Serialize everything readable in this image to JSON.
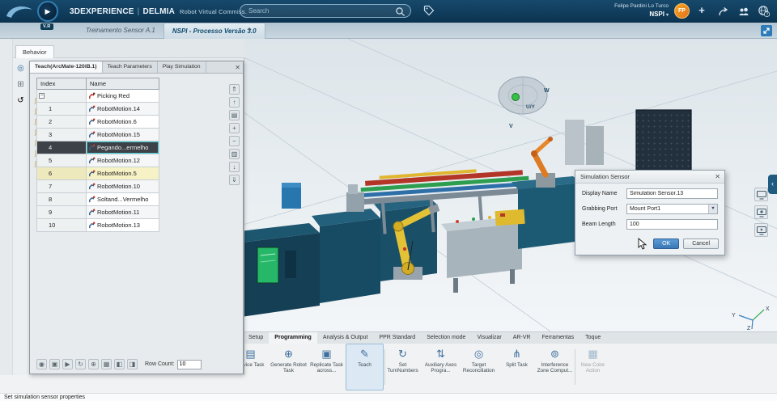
{
  "top_bar": {
    "brand": "3DEXPERIENCE",
    "divider": "|",
    "app": "DELMIA",
    "app_role": "Robot Virtual Commiss.",
    "vr_badge": "V.R",
    "search": {
      "placeholder": "Search"
    },
    "user": {
      "name": "Felipe Pardini Lo Turco",
      "workspace": "NSPI",
      "workspace_caret": "▾",
      "initials": "FP"
    }
  },
  "tab_bar": {
    "tabs": [
      {
        "label": "Treinamento Sensor A.1"
      },
      {
        "label": "NSPI - Processo Versão 3.0",
        "active": true
      }
    ],
    "new_tab": "+"
  },
  "left_panel": {
    "behavior_tab": "Behavior",
    "panel_tools": [
      "vr-compass-icon",
      "behavior-tree-icon",
      "simulation-loop-icon"
    ]
  },
  "teach_window": {
    "tabs": [
      {
        "label": "Teach(ArcMate-120iB.1)",
        "active": true
      },
      {
        "label": "Teach Parameters"
      },
      {
        "label": "Play Simulation"
      }
    ],
    "close": "✕",
    "columns": [
      "Index",
      "Name"
    ],
    "rows": [
      {
        "index": "",
        "name": "Picking Red",
        "group": true
      },
      {
        "index": "1",
        "name": "RobotMotion.14"
      },
      {
        "index": "2",
        "name": "RobotMotion.6"
      },
      {
        "index": "3",
        "name": "RobotMotion.15"
      },
      {
        "index": "4",
        "name": "Pegando...ermelho",
        "selected": true
      },
      {
        "index": "5",
        "name": "RobotMotion.12"
      },
      {
        "index": "6",
        "name": "RobotMotion.5",
        "highlighted": true
      },
      {
        "index": "7",
        "name": "RobotMotion.10"
      },
      {
        "index": "8",
        "name": "Soltand...Vermelho"
      },
      {
        "index": "9",
        "name": "RobotMotion.11"
      },
      {
        "index": "10",
        "name": "RobotMotion.13"
      }
    ],
    "row_tools": [
      "motion-type-icon",
      "motion-type-icon",
      "motion-type-icon",
      "motion-type-icon",
      "motion-type-icon",
      "motion-type-icon",
      "motion-type-icon"
    ],
    "right_tools": [
      "scroll-top-icon",
      "scroll-up-icon",
      "table-grid-icon",
      "add-row-icon",
      "remove-row-icon",
      "table-grid-alt-icon",
      "scroll-down-icon",
      "scroll-bottom-icon"
    ],
    "footer_tools": [
      "target-icon",
      "grid-select-icon",
      "play-icon",
      "refresh-icon",
      "insert-icon",
      "matrix-icon",
      "panel-left-icon",
      "panel-right-icon"
    ],
    "row_count_label": "Row Count:",
    "row_count_value": "10"
  },
  "sensor_dialog": {
    "title": "Simulation Sensor",
    "close": "✕",
    "select_caret": "▼",
    "fields": {
      "display_name_label": "Display Name",
      "display_name_value": "Simulation Sensor.13",
      "grabbing_port_label": "Grabbing Port",
      "grabbing_port_value": "Mount Port1",
      "beam_length_label": "Beam Length",
      "beam_length_value": "100"
    },
    "ok": "OK",
    "cancel": "Cancel"
  },
  "viewport": {
    "compass": {
      "w": "W",
      "uy": "U/Y",
      "v": "V"
    },
    "axes": {
      "x": "X",
      "y": "Y",
      "z": "Z"
    }
  },
  "ribbon": {
    "tabs": [
      {
        "label": "Setup"
      },
      {
        "label": "Programming",
        "active": true
      },
      {
        "label": "Analysis & Output"
      },
      {
        "label": "PPR Standard"
      },
      {
        "label": "Selection mode"
      },
      {
        "label": "Visualizar"
      },
      {
        "label": "AR-VR"
      },
      {
        "label": "Ferramentas"
      },
      {
        "label": "Toque"
      }
    ],
    "buttons": [
      {
        "label": "Device Task",
        "icon": "device-task-icon"
      },
      {
        "label": "Generate Robot Task",
        "icon": "generate-robot-task-icon"
      },
      {
        "label": "Replicate Task across...",
        "icon": "replicate-task-icon",
        "divider_after": true
      },
      {
        "label": "Teach",
        "icon": "teach-icon",
        "active": true,
        "divider_after": true
      },
      {
        "label": "Set TurnNumbers",
        "icon": "turn-numbers-icon"
      },
      {
        "label": "Auxiliary Axes Progra...",
        "icon": "auxiliary-axes-icon"
      },
      {
        "label": "Target Reconciliation",
        "icon": "target-reconciliation-icon"
      },
      {
        "label": "Split Task",
        "icon": "split-task-icon"
      },
      {
        "label": "Interference Zone Comput...",
        "icon": "interference-zone-icon",
        "divider_after": true
      },
      {
        "label": "New Color Action",
        "icon": "new-color-action-icon",
        "disabled": true
      }
    ]
  },
  "status_bar": {
    "message": "Set simulation sensor properties"
  }
}
